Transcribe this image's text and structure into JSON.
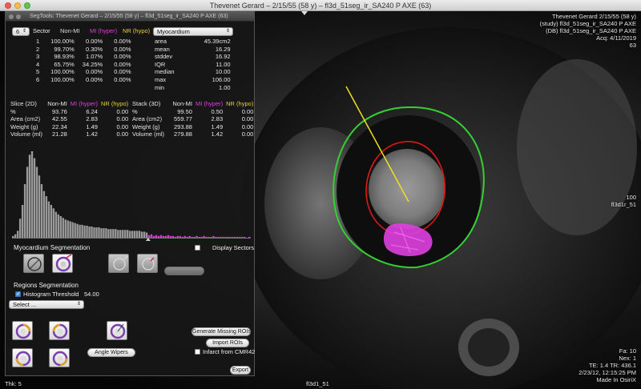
{
  "window": {
    "title": "Thevenet Gerard – 2/15/55 (58 y) – fl3d_51seg_ir_SA240 P AXE (63)"
  },
  "panel": {
    "title": "SegTools: Thevenet Gerard – 2/15/55 (58 y) – fl3d_51seg_ir_SA240 P AXE (63)",
    "sector_select": "6",
    "sector_header": "Sector",
    "col_nonmi": "Non-MI",
    "col_hyper": "MI (hyper)",
    "col_hypo": "NR (hypo)",
    "region_select": "Myocardium",
    "sectors": [
      {
        "n": "1",
        "nonmi": "100.00%",
        "hyper": "0.00%",
        "hypo": "0.00%"
      },
      {
        "n": "2",
        "nonmi": "99.70%",
        "hyper": "0.30%",
        "hypo": "0.00%"
      },
      {
        "n": "3",
        "nonmi": "98.93%",
        "hyper": "1.07%",
        "hypo": "0.00%"
      },
      {
        "n": "4",
        "nonmi": "65.75%",
        "hyper": "34.25%",
        "hypo": "0.00%"
      },
      {
        "n": "5",
        "nonmi": "100.00%",
        "hyper": "0.00%",
        "hypo": "0.00%"
      },
      {
        "n": "6",
        "nonmi": "100.00%",
        "hyper": "0.00%",
        "hypo": "0.00%"
      }
    ],
    "region_stats": [
      {
        "k": "area",
        "v": "45.39cm2"
      },
      {
        "k": "mean",
        "v": "16.29"
      },
      {
        "k": "stddev",
        "v": "16.92"
      },
      {
        "k": "IQR",
        "v": "11.00"
      },
      {
        "k": "median",
        "v": "10.00"
      },
      {
        "k": "max",
        "v": "106.00"
      },
      {
        "k": "min",
        "v": "1.00"
      }
    ],
    "slice_header": "Slice (2D)",
    "slice_rows": [
      {
        "k": "%",
        "nonmi": "93.76",
        "hyper": "6.24",
        "hypo": "0.00"
      },
      {
        "k": "Area (cm2)",
        "nonmi": "42.55",
        "hyper": "2.83",
        "hypo": "0.00"
      },
      {
        "k": "Weight (g)",
        "nonmi": "22.34",
        "hyper": "1.49",
        "hypo": "0.00"
      },
      {
        "k": "Volume (ml)",
        "nonmi": "21.28",
        "hyper": "1.42",
        "hypo": "0.00"
      }
    ],
    "stack_header": "Stack (3D)",
    "stack_rows": [
      {
        "k": "%",
        "nonmi": "99.50",
        "hyper": "0.50",
        "hypo": "0.00"
      },
      {
        "k": "Area (cm2)",
        "nonmi": "559.77",
        "hyper": "2.83",
        "hypo": "0.00"
      },
      {
        "k": "Weight (g)",
        "nonmi": "293.88",
        "hyper": "1.49",
        "hypo": "0.00"
      },
      {
        "k": "Volume (ml)",
        "nonmi": "279.88",
        "hyper": "1.42",
        "hypo": "0.00"
      }
    ],
    "histogram": {
      "threshold_bin": 57,
      "values": [
        2,
        4,
        8,
        22,
        38,
        62,
        82,
        96,
        100,
        92,
        82,
        72,
        62,
        54,
        48,
        42,
        38,
        34,
        30,
        27,
        25,
        23,
        21,
        20,
        19,
        18,
        17,
        16,
        15,
        15,
        14,
        14,
        13,
        13,
        12,
        12,
        12,
        11,
        11,
        11,
        10,
        10,
        10,
        10,
        9,
        9,
        9,
        9,
        9,
        8,
        8,
        8,
        8,
        8,
        7,
        7,
        6,
        3,
        4,
        2,
        3,
        2,
        3,
        2,
        2,
        3,
        2,
        2,
        1,
        2,
        2,
        1,
        2,
        1,
        2,
        1,
        1,
        2,
        1,
        1,
        2,
        1,
        1,
        1,
        2,
        1,
        1,
        1,
        1,
        1,
        1,
        1,
        1,
        1,
        1,
        1,
        1,
        1,
        0,
        1
      ]
    },
    "myo_seg_label": "Myocardium Segmentation",
    "display_sectors_label": "Display Sectors",
    "regions_seg_label": "Regions Segmentation",
    "histogram_threshold_label": "Histogram Threshold",
    "histogram_threshold_value": "54.00",
    "select_placeholder": "Select ...",
    "btn_generate": "Generate Missing ROIs",
    "btn_import": "Import ROIs",
    "infarct_label": "Infarct from CMR42",
    "btn_angle": "Angle Wipers",
    "btn_export": "Export"
  },
  "overlay": {
    "top_right": [
      "Thevenet Gerard 2/15/55 (58 y)",
      "(study) fl3d_51seg_ir_SA240 P AXE",
      "(DB) fl3d_51seg_ir_SA240 P AXE",
      "Acq: 4/11/2019",
      "63"
    ],
    "right_mid": [
      "100",
      "fl3d1r_51"
    ],
    "bottom_right": [
      "Fa: 10",
      "Nex: 1",
      "TE: 1.4 TR: 436.1",
      "2/23/12, 12:15:25 PM",
      "Made In OsiriX"
    ],
    "bottom_left": "Thk: 5",
    "bottom_center": "fl3d1_51"
  },
  "colors": {
    "epicardium": "#32d232",
    "endocardium": "#e01818",
    "axis_line": "#f0e020",
    "infarct": "#e040e0"
  }
}
